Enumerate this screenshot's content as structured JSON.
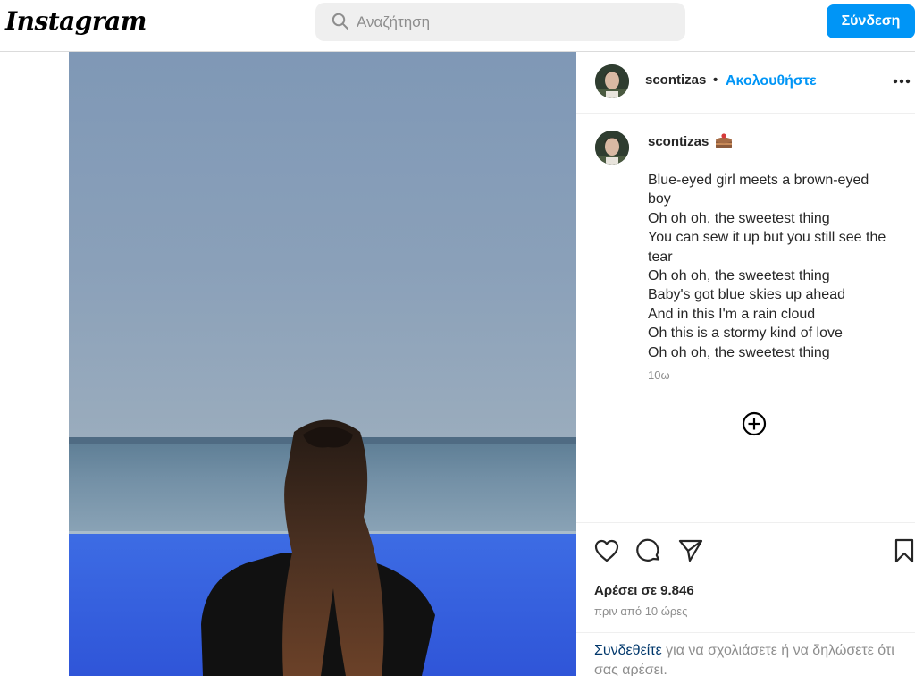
{
  "header": {
    "logo_text": "Instagram",
    "search_placeholder": "Αναζήτηση",
    "login_label": "Σύνδεση"
  },
  "post": {
    "username": "scontizas",
    "separator": "•",
    "follow_label": "Ακολουθήστε",
    "caption_lines": [
      "Blue-eyed girl meets a brown-eyed",
      "boy",
      "Oh oh oh, the sweetest thing",
      "You can sew it up but you still see the",
      "tear",
      "Oh oh oh, the sweetest thing",
      "Baby's got blue skies up ahead",
      "And in this I'm a rain cloud",
      "Oh this is a stormy kind of love",
      "Oh oh oh, the sweetest thing"
    ],
    "caption_time": "10ω",
    "likes": "Αρέσει σε 9.846",
    "post_time": "πριν από 10 ώρες",
    "login_prompt_link": "Συνδεθείτε",
    "login_prompt_text": "για να σχολιάσετε ή να δηλώσετε ότι σας αρέσει."
  },
  "icons": {
    "search": "search-icon",
    "more": "more-options-icon",
    "badge": "cake-emoji-icon",
    "add_comment": "add-circle-icon",
    "like": "heart-icon",
    "comment": "comment-bubble-icon",
    "share": "paper-plane-icon",
    "save": "bookmark-icon"
  },
  "colors": {
    "accent": "#0095f6",
    "link_dark": "#00376b",
    "text": "#262626",
    "muted": "#8e8e8e",
    "sky": "#8399b5",
    "pool": "#3e6ee3"
  }
}
